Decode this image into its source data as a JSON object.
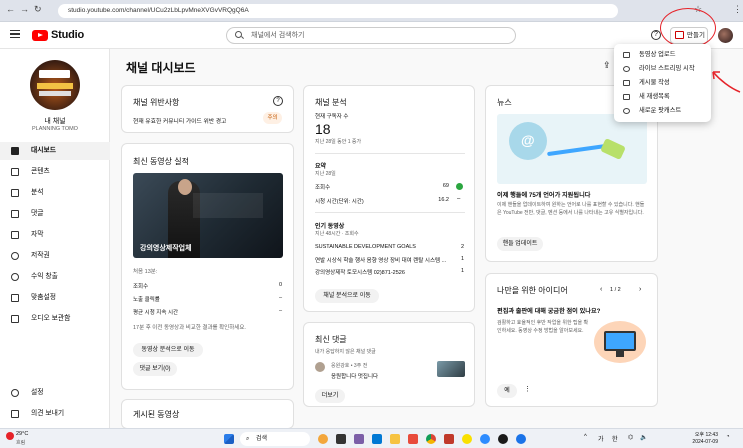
{
  "browser": {
    "url": "studio.youtube.com/channel/UCu2zLbLpvMneXVGvVRQgQ6A"
  },
  "header": {
    "logo_text": "Studio",
    "search_placeholder": "채널에서 검색하기",
    "create_label": "만들기",
    "help_label": "?"
  },
  "create_menu": {
    "items": [
      {
        "label": "동영상 업로드",
        "icon": "upload-icon"
      },
      {
        "label": "라이브 스트리밍 시작",
        "icon": "live-icon"
      },
      {
        "label": "게시물 작성",
        "icon": "post-icon"
      },
      {
        "label": "새 재생목록",
        "icon": "playlist-add-icon"
      },
      {
        "label": "새로운 팟캐스트",
        "icon": "podcast-icon"
      }
    ]
  },
  "sidebar": {
    "channel_name": "내 채널",
    "channel_subtitle": "PLANNING TOMO",
    "items": [
      {
        "label": "대시보드",
        "icon": "dashboard-icon",
        "active": true
      },
      {
        "label": "콘텐츠",
        "icon": "content-icon"
      },
      {
        "label": "분석",
        "icon": "analytics-icon"
      },
      {
        "label": "댓글",
        "icon": "comments-icon"
      },
      {
        "label": "자막",
        "icon": "subtitles-icon"
      },
      {
        "label": "저작권",
        "icon": "copyright-icon"
      },
      {
        "label": "수익 창출",
        "icon": "monetization-icon"
      },
      {
        "label": "맞춤설정",
        "icon": "customization-icon"
      },
      {
        "label": "오디오 보관함",
        "icon": "audio-library-icon"
      }
    ],
    "bottom_items": [
      {
        "label": "설정",
        "icon": "settings-icon"
      },
      {
        "label": "의견 보내기",
        "icon": "feedback-icon"
      }
    ]
  },
  "main": {
    "page_title": "채널 대시보드",
    "violations": {
      "title": "채널 위반사항",
      "text": "현재 유효한 커뮤니티 가이드 위반 경고",
      "badge": "주의"
    },
    "latest_video": {
      "title": "최신 동영상 실적",
      "thumb_caption": "강의영상제작업체",
      "period": "처음 13분:",
      "rows": [
        {
          "label": "조회수",
          "value": "0"
        },
        {
          "label": "노출 클릭률",
          "value": "–"
        },
        {
          "label": "평균 시청 지속 시간",
          "value": "–"
        }
      ],
      "note": "17분 후 이전 동영상과 비교한 결과를 확인하세요.",
      "btn_analytics": "동영상 분석으로 이동",
      "btn_comments": "댓글 보기(0)"
    },
    "published": {
      "title": "게시된 동영상"
    },
    "analytics": {
      "title": "채널 분석",
      "subs_label": "현재 구독자 수",
      "subs_value": "18",
      "subs_change": "지난 28일 동안 1 증가",
      "summary_title": "요약",
      "summary_period": "지난 28일",
      "summary_rows": [
        {
          "label": "조회수",
          "value": "69"
        },
        {
          "label": "시청 시간(단위: 시간)",
          "value": "16.2"
        }
      ],
      "popular_title": "인기 동영상",
      "popular_period": "지난 48시간 · 조회수",
      "popular_rows": [
        {
          "label": "SUSTAINABLE DEVELOPMENT GOALS",
          "value": "2"
        },
        {
          "label": "연발 시상식 학술 행사 음향 영상 장비 대여 렌탈 시스템 ...",
          "value": "1"
        },
        {
          "label": "강의영상제작 토모시스템 02)871-2526",
          "value": "1"
        }
      ],
      "btn": "채널 분석으로 이동"
    },
    "comments": {
      "title": "최신 댓글",
      "subtitle": "내가 응답하지 않은 채널 댓글",
      "author": "응원강호 • 3주 전",
      "text": "응원합니다 멋집니다",
      "btn": "더보기"
    },
    "news": {
      "title": "뉴스",
      "headline": "이제 행들에 75개 언어가 지원됩니다",
      "body": "이제 핸들을 업데이트하여 원하는 언어로 나를 표현할 수 있습니다. 핸들은 YouTube 전반, 댓글, 멘션 등에서 나를 나타내는 고유 식별자입니다.",
      "btn": "핸들 업데이트"
    },
    "ideas": {
      "title": "나만을 위한 아이디어",
      "pager": "1 / 2",
      "headline": "편집과 출판에 대해 궁금한 점이 있나요?",
      "body": "검활하고 효율적인 후반 작업을 위한 팁을 확인하세요. 동영상 수정 방법을 알아보세요.",
      "btn": "예"
    }
  },
  "taskbar": {
    "weather_temp": "29°C",
    "weather_text": "흐림",
    "search_placeholder": "검색",
    "time": "오후 12:43",
    "date": "2024-07-09",
    "lang": "가",
    "ime": "한"
  },
  "colors": {
    "youtube_red": "#ff0000",
    "annotation_red": "#e6232a",
    "success_green": "#2ba640",
    "warning_orange": "#c25700"
  }
}
